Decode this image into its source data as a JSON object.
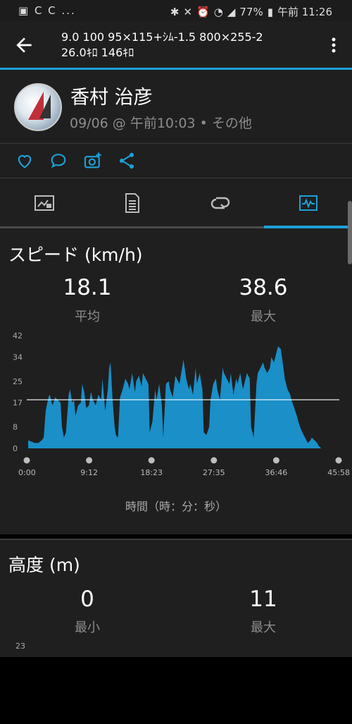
{
  "status": {
    "left_icons": "▣ C C ...",
    "battery": "77%",
    "time": "午前 11:26"
  },
  "toolbar": {
    "title_line1": "9.0 100 95×115+ｼﾑ-1.5 800×255-2",
    "title_line2": "26.0ｷﾛ 146ｷﾛ"
  },
  "profile": {
    "name": "香村 治彦",
    "subtitle": "09/06 @ 午前10:03 • その他"
  },
  "colors": {
    "accent": "#1da1d8",
    "chart_fill": "#1a8fc8",
    "card": "#1f1f1f"
  },
  "icons": [
    "back-arrow-icon",
    "more-vert-icon",
    "heart-icon",
    "comment-icon",
    "camera-add-icon",
    "share-icon",
    "summary-tab-icon",
    "details-tab-icon",
    "laps-tab-icon",
    "charts-tab-icon"
  ],
  "speed": {
    "title": "スピード (km/h)",
    "avg_value": "18.1",
    "avg_label": "平均",
    "max_value": "38.6",
    "max_label": "最大",
    "x_axis_title": "時間（時：分：秒）"
  },
  "chart_data": {
    "type": "area",
    "y_ticks": [
      "0",
      "8",
      "17",
      "25",
      "34",
      "42"
    ],
    "ylim": [
      0,
      42
    ],
    "x_ticks": [
      "0:00",
      "9:12",
      "18:23",
      "27:35",
      "36:46",
      "45:58"
    ],
    "xlim_min": [
      0,
      45.97
    ],
    "average_line": 18.1,
    "x": [
      0,
      1,
      1.5,
      2,
      2.3,
      2.6,
      3,
      3.2,
      3.6,
      4,
      4.4,
      4.8,
      5,
      5.3,
      5.6,
      6,
      6.2,
      6.5,
      6.8,
      7,
      7.4,
      7.8,
      8,
      8.3,
      8.6,
      9,
      9.3,
      9.6,
      10,
      10.4,
      10.8,
      11,
      11.4,
      11.8,
      12,
      12.2,
      12.5,
      12.8,
      13,
      13.3,
      13.6,
      14,
      14.4,
      14.8,
      15,
      15.4,
      15.8,
      16,
      16.4,
      16.8,
      17,
      17.4,
      17.8,
      18,
      18.4,
      18.8,
      19,
      19.4,
      19.8,
      20,
      20.4,
      20.8,
      21,
      21.4,
      21.8,
      22,
      22.4,
      22.8,
      23,
      23.4,
      23.8,
      24,
      24.4,
      24.8,
      25,
      25.4,
      25.8,
      26,
      26.4,
      26.8,
      27,
      27.4,
      27.8,
      28,
      28.4,
      28.8,
      29,
      29.4,
      29.8,
      30,
      30.4,
      30.8,
      31,
      31.4,
      31.8,
      32,
      32.4,
      32.8,
      33,
      33.4,
      33.8,
      34,
      34.4,
      34.8,
      35,
      35.4,
      35.8,
      36,
      36.4,
      36.8,
      37,
      37.4,
      37.8,
      38,
      38.4,
      38.8,
      39,
      39.4,
      39.8,
      40,
      40.4,
      40.8,
      41,
      41.4,
      41.8,
      42,
      42.4,
      42.8,
      43,
      43.4,
      43.8,
      44,
      44.4,
      44.8,
      45,
      45.4,
      45.97
    ],
    "values": [
      3,
      2,
      2,
      3,
      4,
      14,
      19,
      20,
      16,
      19,
      18,
      17,
      8,
      4,
      6,
      20,
      22,
      17,
      18,
      12,
      16,
      17,
      24,
      21,
      15,
      16,
      21,
      18,
      16,
      20,
      18,
      26,
      14,
      22,
      30,
      32,
      18,
      8,
      5,
      4,
      19,
      22,
      26,
      24,
      22,
      28,
      21,
      25,
      27,
      23,
      28,
      26,
      24,
      6,
      10,
      22,
      18,
      24,
      16,
      4,
      24,
      25,
      22,
      19,
      27,
      26,
      24,
      30,
      33,
      26,
      22,
      24,
      20,
      30,
      24,
      28,
      22,
      6,
      5,
      8,
      18,
      24,
      26,
      22,
      18,
      30,
      28,
      26,
      24,
      28,
      20,
      26,
      24,
      28,
      22,
      24,
      28,
      26,
      8,
      4,
      24,
      28,
      30,
      32,
      30,
      28,
      30,
      34,
      32,
      36,
      38,
      37,
      30,
      26,
      22,
      20,
      18,
      15,
      12,
      10,
      7,
      5,
      4,
      2,
      3,
      4,
      3,
      2,
      1,
      0,
      0,
      0,
      0,
      0,
      0,
      0,
      0,
      0,
      0,
      0,
      0,
      0
    ]
  },
  "altitude": {
    "title": "高度 (m)",
    "min_value": "0",
    "min_label": "最小",
    "max_value": "11",
    "max_label": "最大",
    "y_top_tick": "23"
  }
}
